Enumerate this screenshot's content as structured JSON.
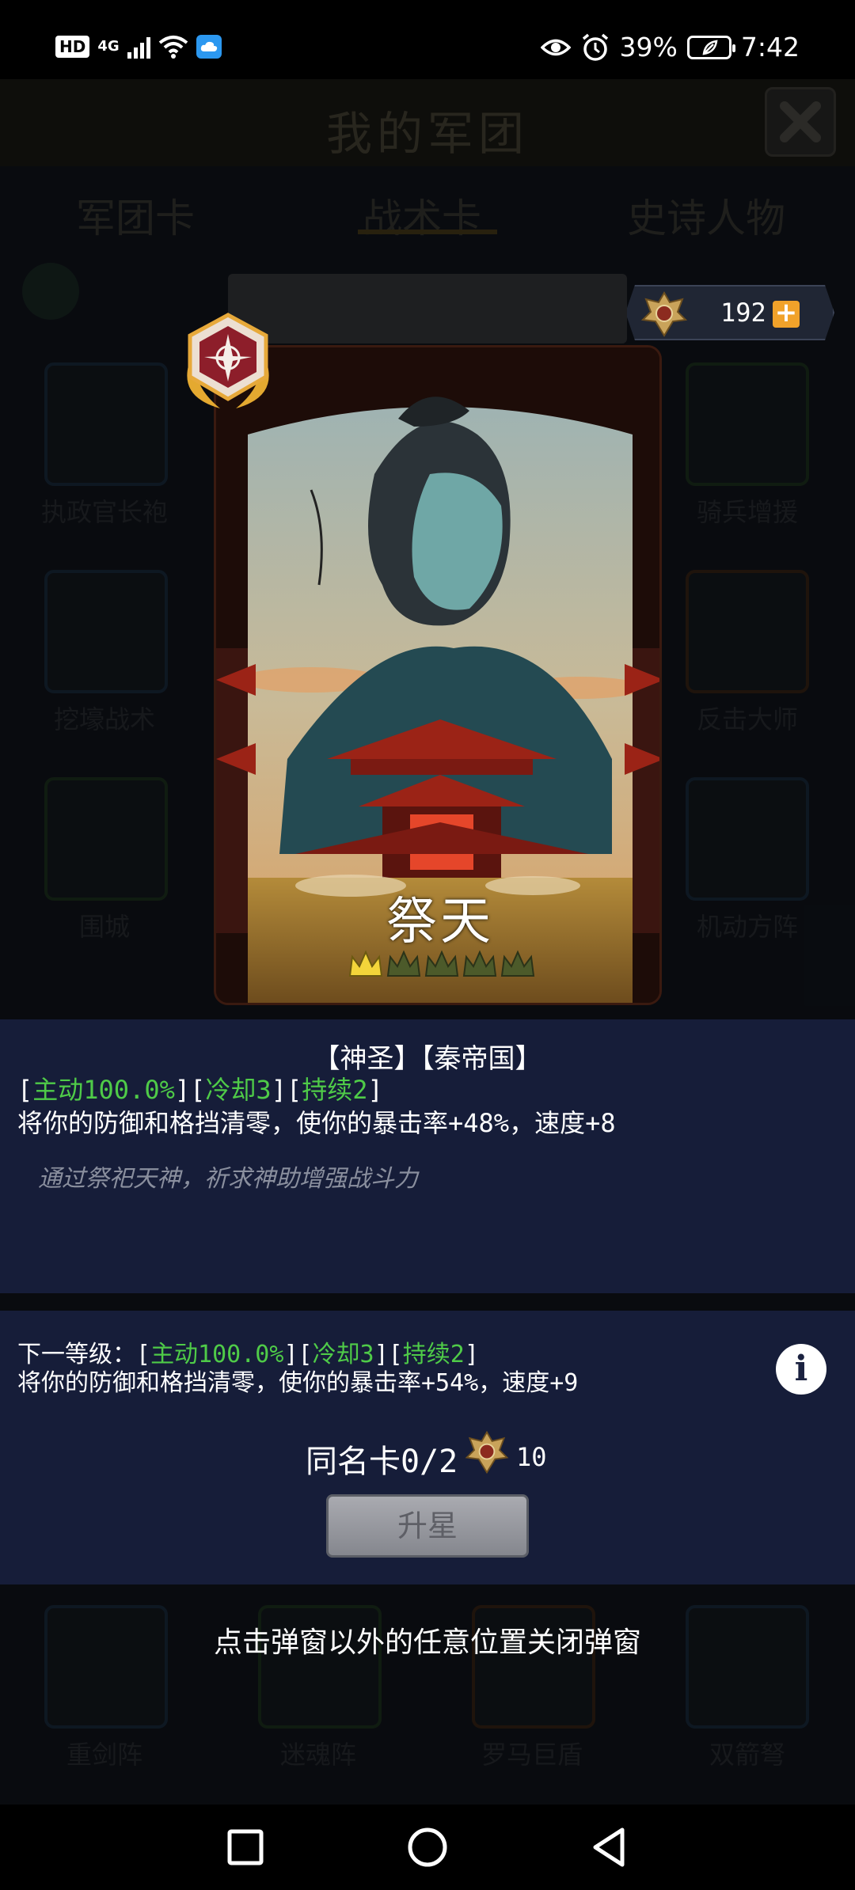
{
  "status_bar": {
    "hd": "HD",
    "network": "4G",
    "battery_percent": "39%",
    "time": "7:42"
  },
  "game": {
    "title": "我的军团",
    "tabs": [
      {
        "label": "军团卡"
      },
      {
        "label": "战术卡"
      },
      {
        "label": "史诗人物"
      }
    ],
    "grid_labels": [
      "执政官长袍",
      "骑兵增援",
      "挖壕战术",
      "反击大师",
      "围城",
      "机动方阵",
      "重剑阵",
      "迷魂阵",
      "罗马巨盾",
      "双箭弩"
    ]
  },
  "currency": {
    "value": "192",
    "plus": "+"
  },
  "card": {
    "name": "祭天",
    "stars": 1,
    "max_stars": 5
  },
  "details": {
    "tags": "【神圣】【秦帝国】",
    "stats_active": "主动100.0%",
    "stats_cooldown": "冷却3",
    "stats_duration": "持续2",
    "effect": "将你的防御和格挡清零，使你的暴击率+48%，速度+8",
    "flavor": "通过祭祀天神，祈求神助增强战斗力",
    "next_level_prefix": "下一等级：",
    "next_active": "主动100.0%",
    "next_cooldown": "冷却3",
    "next_duration": "持续2",
    "next_effect": "将你的防御和格挡清零，使你的暴击率+54%，速度+9",
    "duplicate_label": "同名卡0/2",
    "upgrade_cost": "10",
    "upgrade_button": "升星",
    "close_hint": "点击弹窗以外的任意位置关闭弹窗"
  }
}
